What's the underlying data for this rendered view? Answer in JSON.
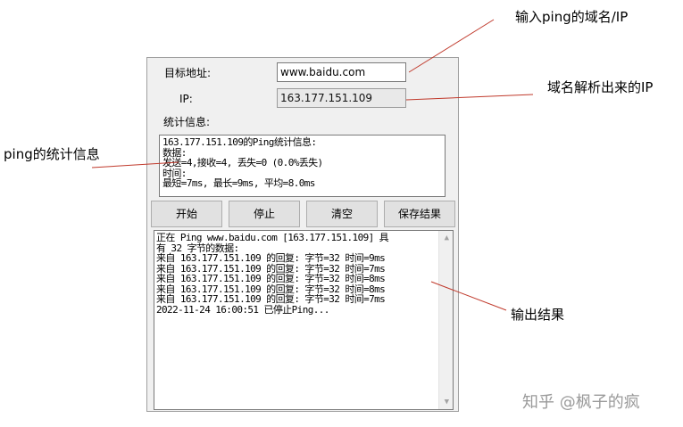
{
  "dialog": {
    "target_label": "目标地址:",
    "target_value": "www.baidu.com",
    "ip_label": "IP:",
    "ip_value": "163.177.151.109",
    "stats_label": "统计信息:",
    "stats_lines": [
      "163.177.151.109的Ping统计信息:",
      "数据:",
      "发送=4,接收=4, 丢失=0 (0.0%丢失)",
      "时间:",
      "最短=7ms, 最长=9ms, 平均=8.0ms"
    ],
    "buttons": {
      "start": "开始",
      "stop": "停止",
      "clear": "清空",
      "save": "保存结果"
    },
    "output_lines": [
      "正在 Ping www.baidu.com [163.177.151.109] 具",
      "有 32 字节的数据:",
      "来自 163.177.151.109 的回复: 字节=32 时间=9ms",
      "来自 163.177.151.109 的回复: 字节=32 时间=7ms",
      "来自 163.177.151.109 的回复: 字节=32 时间=8ms",
      "来自 163.177.151.109 的回复: 字节=32 时间=8ms",
      "来自 163.177.151.109 的回复: 字节=32 时间=7ms",
      "2022-11-24 16:00:51 已停止Ping..."
    ]
  },
  "annotations": {
    "input_domain": "输入ping的域名/IP",
    "resolved_ip": "域名解析出来的IP",
    "ping_stats": "ping的统计信息",
    "output_result": "输出结果"
  },
  "watermark": "知乎 @枫子的疯",
  "colors": {
    "annotation_line": "#c0392b",
    "window_bg": "#f0f0f0",
    "button_bg": "#e1e1e1"
  },
  "icons": {
    "scroll_up": "scroll-up-arrow-icon",
    "scroll_down": "scroll-down-arrow-icon"
  }
}
